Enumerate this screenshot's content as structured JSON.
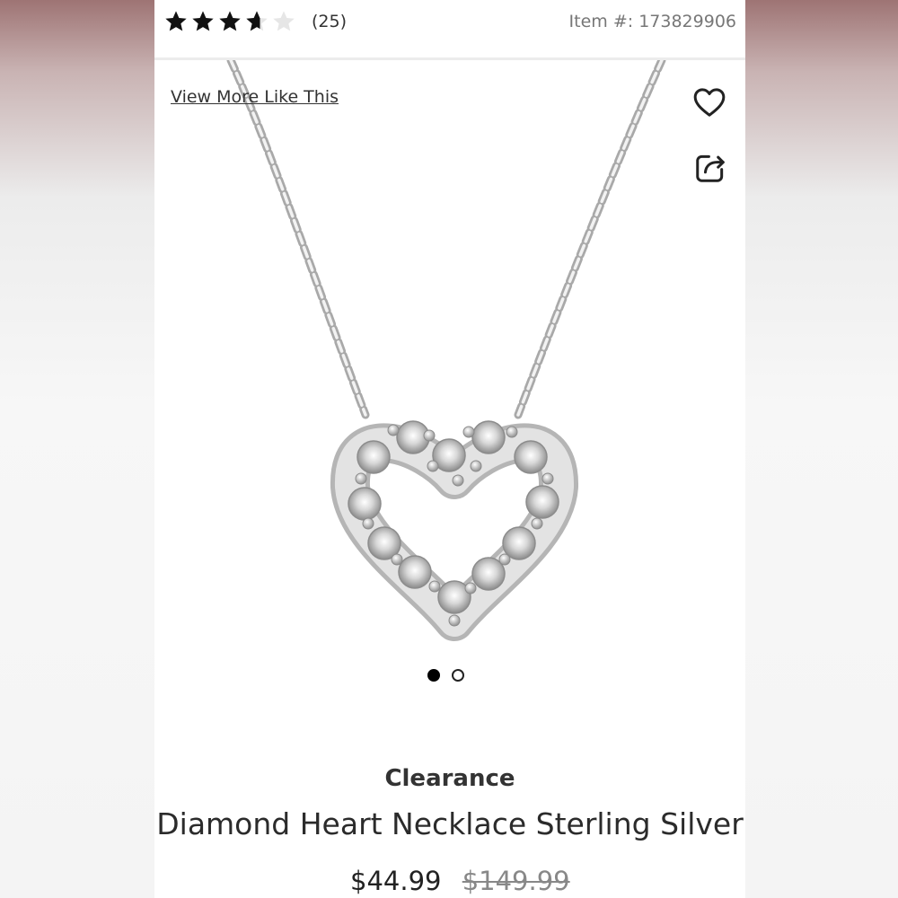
{
  "rating": {
    "stars_filled": 4,
    "stars_total": 5,
    "count_text": "(25)"
  },
  "item_number": "Item #: 173829906",
  "links": {
    "view_more": "View More Like This"
  },
  "icons": {
    "favorite": "heart-icon",
    "share": "share-icon"
  },
  "carousel": {
    "total": 2,
    "active_index": 0
  },
  "product": {
    "badge": "Clearance",
    "title": "Diamond Heart Necklace Sterling Silver",
    "price": "$44.99",
    "original_price": "$149.99"
  },
  "colors": {
    "text": "#333333",
    "muted": "#777777",
    "star": "#111111",
    "background_tint": "#9e7474"
  }
}
